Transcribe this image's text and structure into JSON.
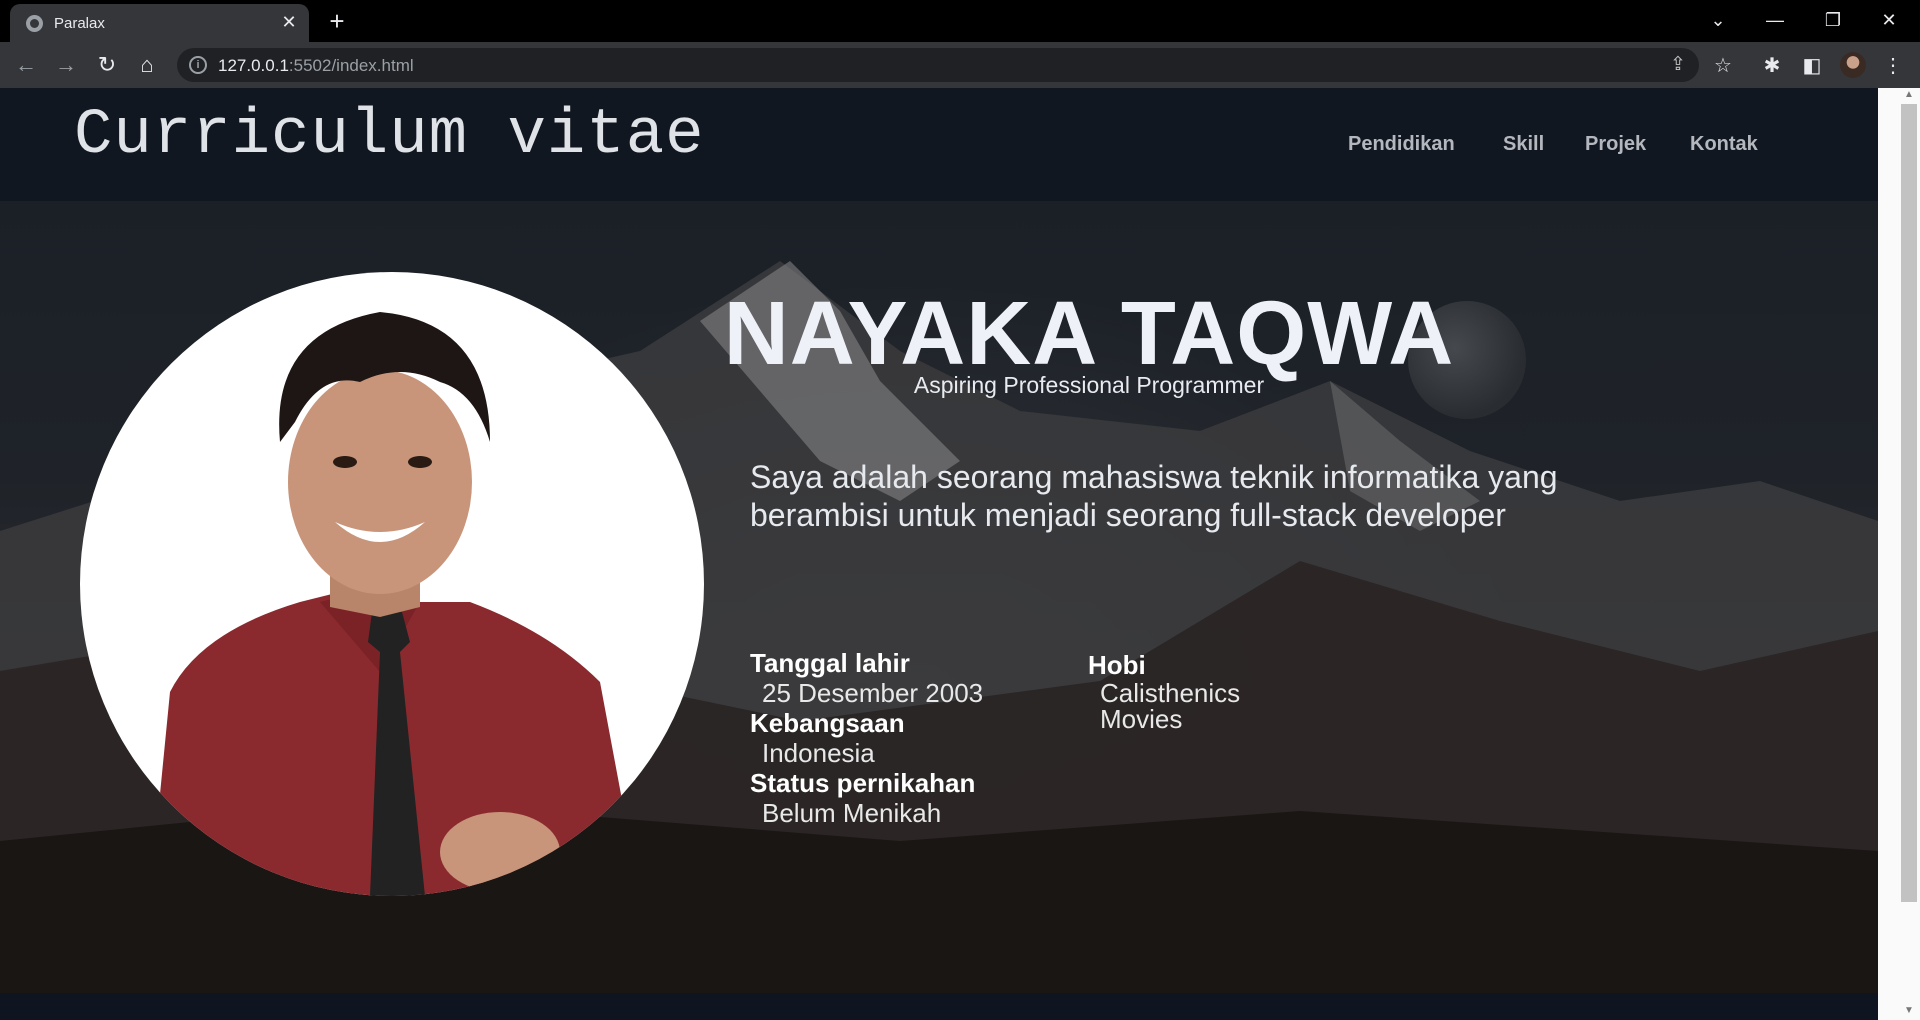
{
  "browser": {
    "tab_title": "Paralax",
    "url_host": "127.0.0.1",
    "url_path": ":5502/index.html"
  },
  "header": {
    "site_title": "Curriculum vitae",
    "nav": [
      "Pendidikan",
      "Skill",
      "Projek",
      "Kontak"
    ]
  },
  "profile": {
    "name": "NAYAKA TAQWA",
    "tagline": "Aspiring Professional Programmer",
    "bio": "Saya adalah seorang mahasiswa teknik informatika yang berambisi untuk menjadi seorang full-stack developer",
    "details": [
      {
        "label": "Tanggal lahir",
        "value": "25 Desember 2003"
      },
      {
        "label": "Kebangsaan",
        "value": "Indonesia"
      },
      {
        "label": "Status pernikahan",
        "value": "Belum Menikah"
      }
    ],
    "hobby_label": "Hobi",
    "hobbies": [
      "Calisthenics",
      "Movies"
    ]
  },
  "colors": {
    "header_bg": "#111720",
    "text_light": "#eef2f8",
    "shirt": "#8b2a2e"
  }
}
